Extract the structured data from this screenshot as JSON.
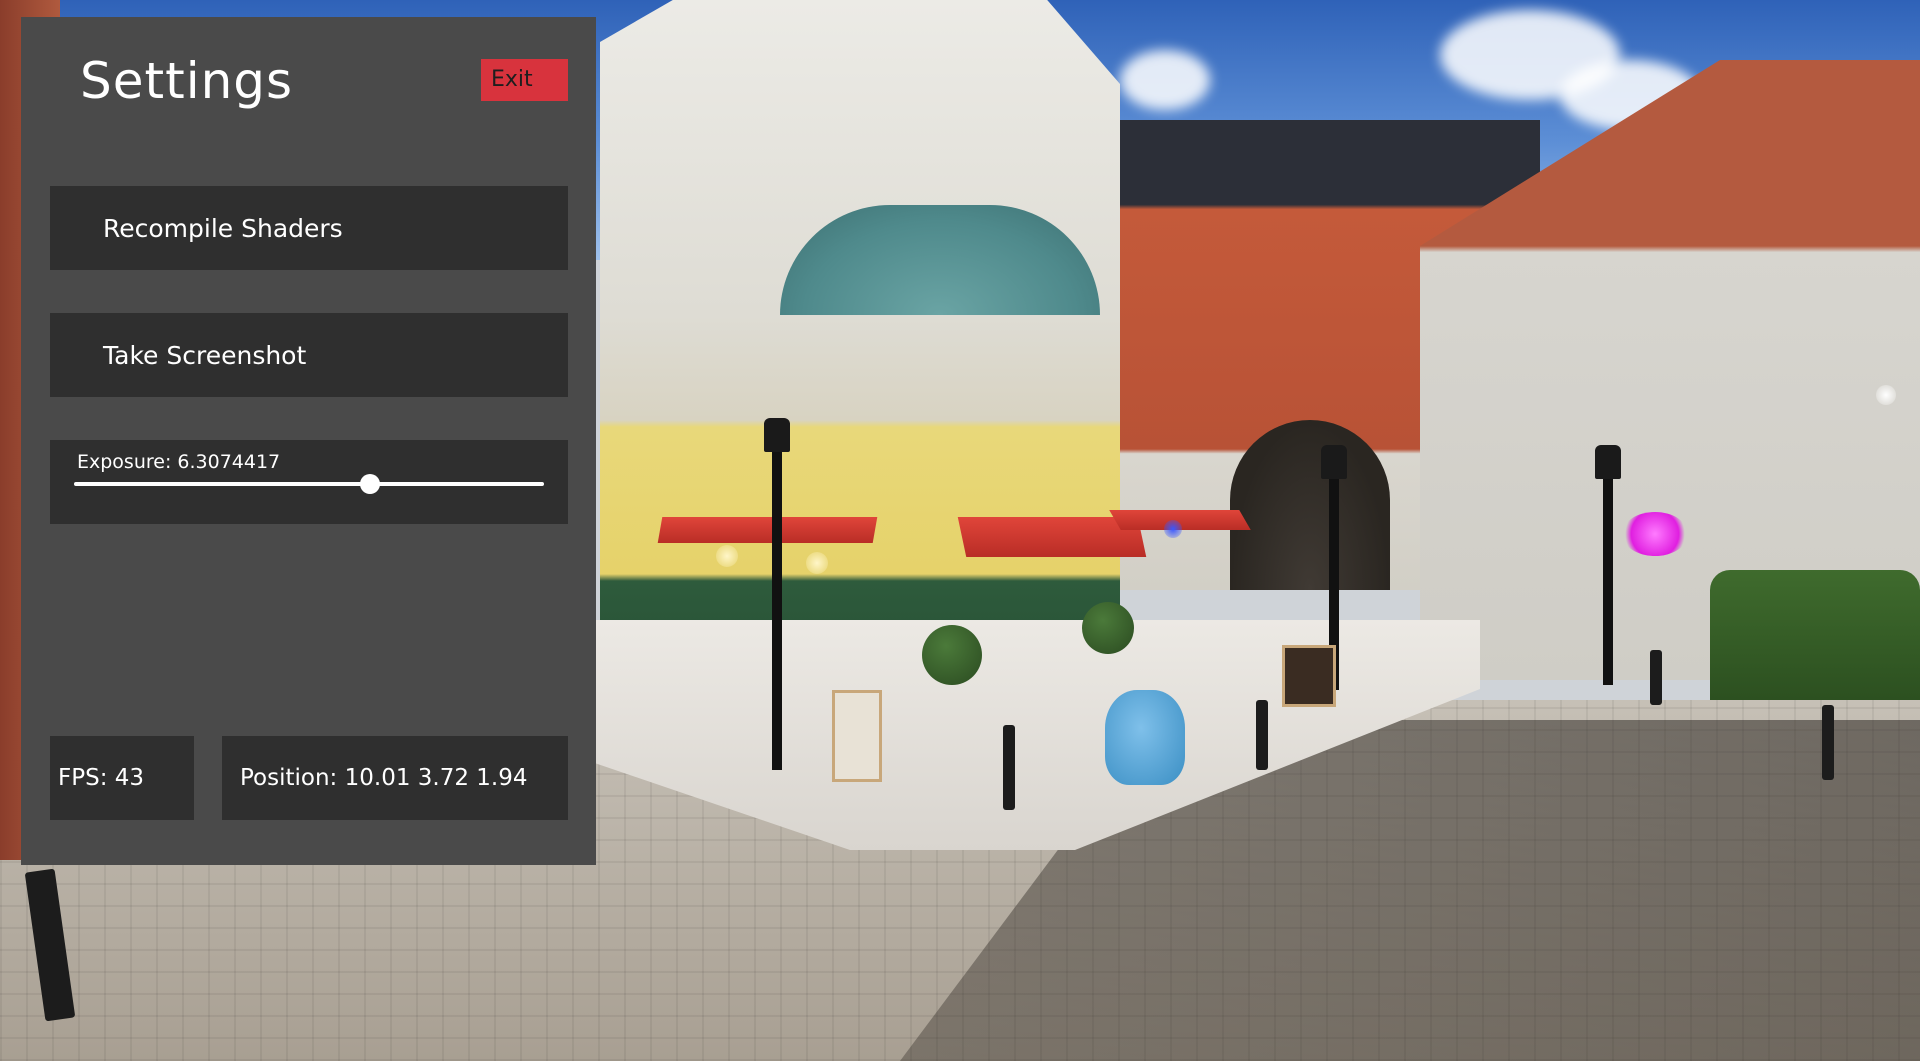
{
  "panel": {
    "title": "Settings",
    "exit_label": "Exit",
    "recompile_label": "Recompile Shaders",
    "screenshot_label": "Take Screenshot",
    "exposure": {
      "label_text": "Exposure: 6.3074417",
      "slider_fraction": 0.63
    },
    "fps_text": "FPS: 43",
    "position_text": "Position: 10.01 3.72 1.94"
  },
  "colors": {
    "panel_bg": "#4a4a4a",
    "control_bg": "#2f2f2f",
    "exit_bg": "#d8333d",
    "text": "#ffffff"
  },
  "icons": {
    "slider_thumb": "circle-knob"
  }
}
